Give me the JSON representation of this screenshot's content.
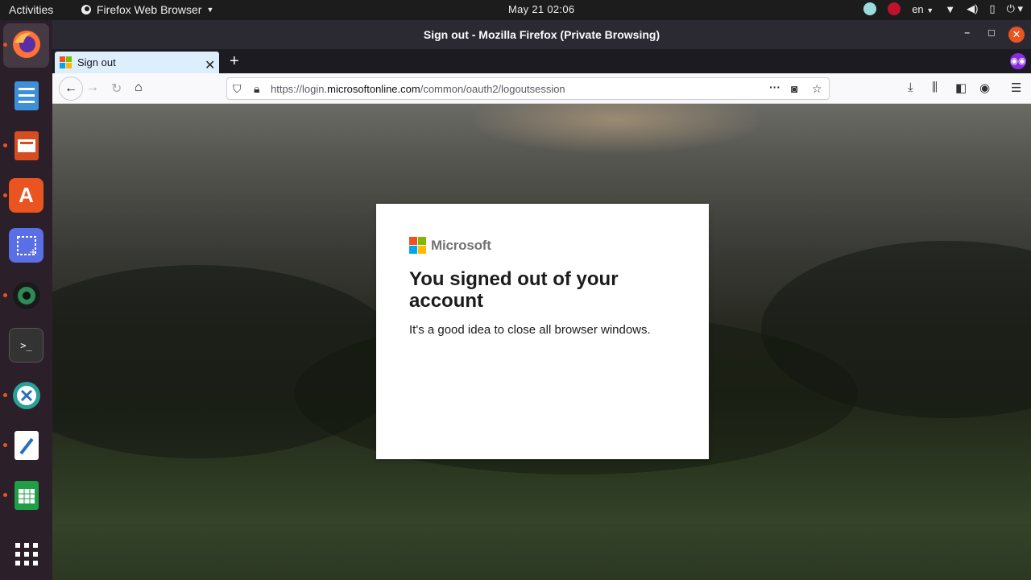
{
  "topbar": {
    "activities": "Activities",
    "app_name": "Firefox Web Browser",
    "clock": "May 21  02:06",
    "lang": "en"
  },
  "window": {
    "title": "Sign out - Mozilla Firefox (Private Browsing)",
    "minimize": "–",
    "maximize": "◻",
    "close": "✕"
  },
  "tabs": [
    {
      "label": "Sign out"
    }
  ],
  "navbar": {
    "url_prefix": "https://login.",
    "url_domain": "microsoftonline.com",
    "url_path": "/common/oauth2/logoutsession"
  },
  "card": {
    "brand": "Microsoft",
    "heading": "You signed out of your account",
    "message": "It's a good idea to close all browser windows."
  },
  "colors": {
    "ms_red": "#f25022",
    "ms_green": "#7fba00",
    "ms_blue": "#00a4ef",
    "ms_yellow": "#ffb900",
    "ubuntu_orange": "#e95420"
  }
}
